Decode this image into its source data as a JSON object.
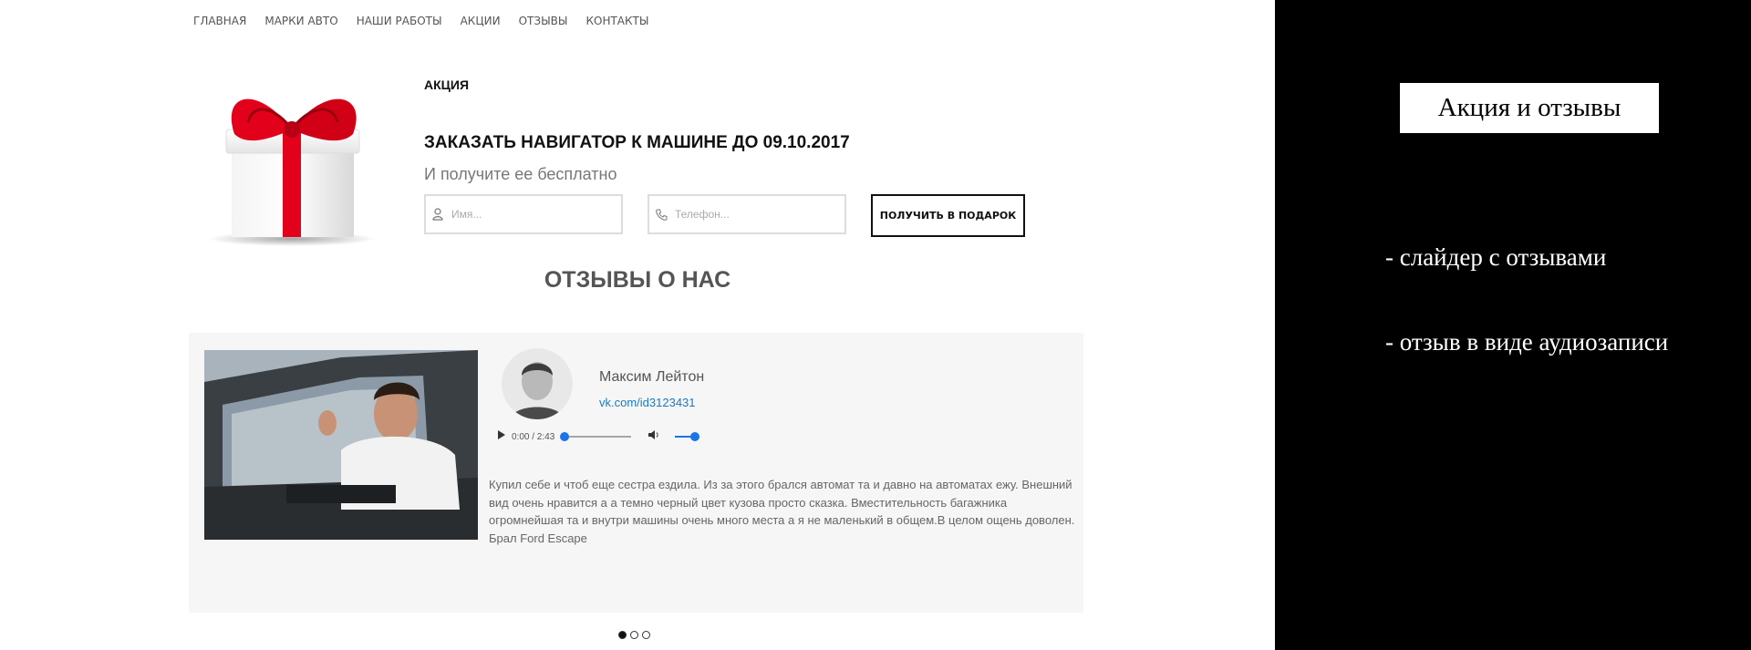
{
  "nav": {
    "items": [
      "ГЛАВНАЯ",
      "МАРКИ АВТО",
      "НАШИ РАБОТЫ",
      "АКЦИИ",
      "ОТЗЫВЫ",
      "КОНТАКТЫ"
    ]
  },
  "promo": {
    "label": "АКЦИЯ",
    "title": "ЗАКАЗАТЬ НАВИГАТОР К МАШИНЕ ДО 09.10.2017",
    "subtitle": "И получите ее бесплатно",
    "name_placeholder": "Имя...",
    "phone_placeholder": "Телефон...",
    "button_label": "ПОЛУЧИТЬ В ПОДАРОК"
  },
  "reviews": {
    "title": "ОТЗЫВЫ О НАС",
    "reviewer_name": "Максим Лейтон",
    "vk_link": "vk.com/id3123431",
    "audio_time": "0:00 / 2:43",
    "text": "Купил себе и чтоб еще сестра ездила. Из за этого брался автомат та и давно на автоматах ежу. Внешний вид очень нравится а а темно черный цвет кузова просто сказка. Вместительность багажника огромнейшая та и внутри машины очень много места а я не маленький в общем.В целом ощень доволен. Брал Ford Escape",
    "slide_count": 3,
    "active_slide": 1
  },
  "panel": {
    "title": "Акция и отзывы",
    "notes": [
      "-  слайдер с отзывами",
      "- отзыв в виде аудиозаписи"
    ]
  },
  "colors": {
    "accent_blue": "#1a7bbf",
    "audio_blue": "#1a73e8",
    "gift_red": "#e2001a",
    "panel_bg": "#000000"
  },
  "icons": [
    "user-icon",
    "phone-icon",
    "play-icon",
    "volume-icon",
    "gift-box-icon"
  ]
}
